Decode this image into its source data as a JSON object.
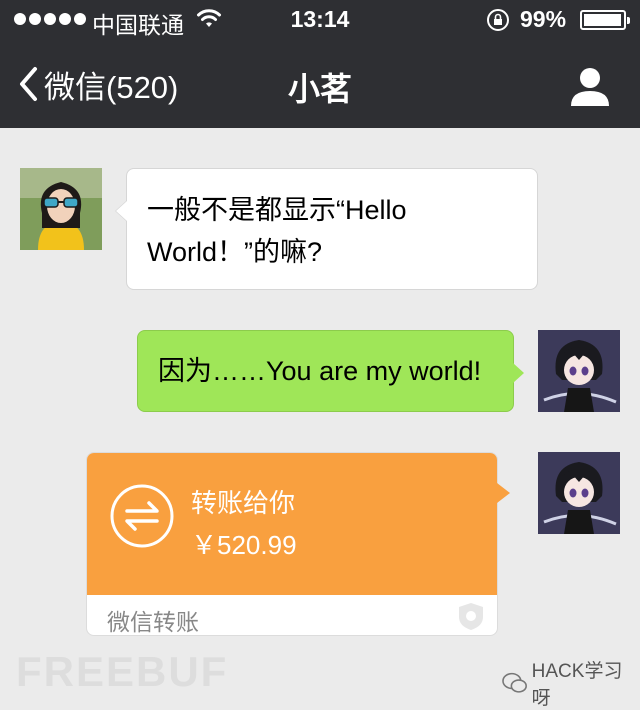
{
  "status_bar": {
    "carrier": "中国联通",
    "time": "13:14",
    "battery_percent": "99%"
  },
  "nav": {
    "back_label": "微信(520)",
    "title": "小茗"
  },
  "messages": [
    {
      "direction": "incoming",
      "text_line1": "一般不是都显示“Hello",
      "text_line2": "World！”的嘛?"
    },
    {
      "direction": "outgoing",
      "text": "因为……You are my world!"
    }
  ],
  "transfer": {
    "title": "转账给你",
    "amount": "￥520.99",
    "footer": "微信转账"
  },
  "watermarks": {
    "left": "FREEBUF",
    "right": "HACK学习呀"
  },
  "colors": {
    "bar_bg": "#2e2f33",
    "chat_bg": "#ebebeb",
    "outgoing_bubble": "#9fe658",
    "transfer_orange": "#f9a03f"
  }
}
